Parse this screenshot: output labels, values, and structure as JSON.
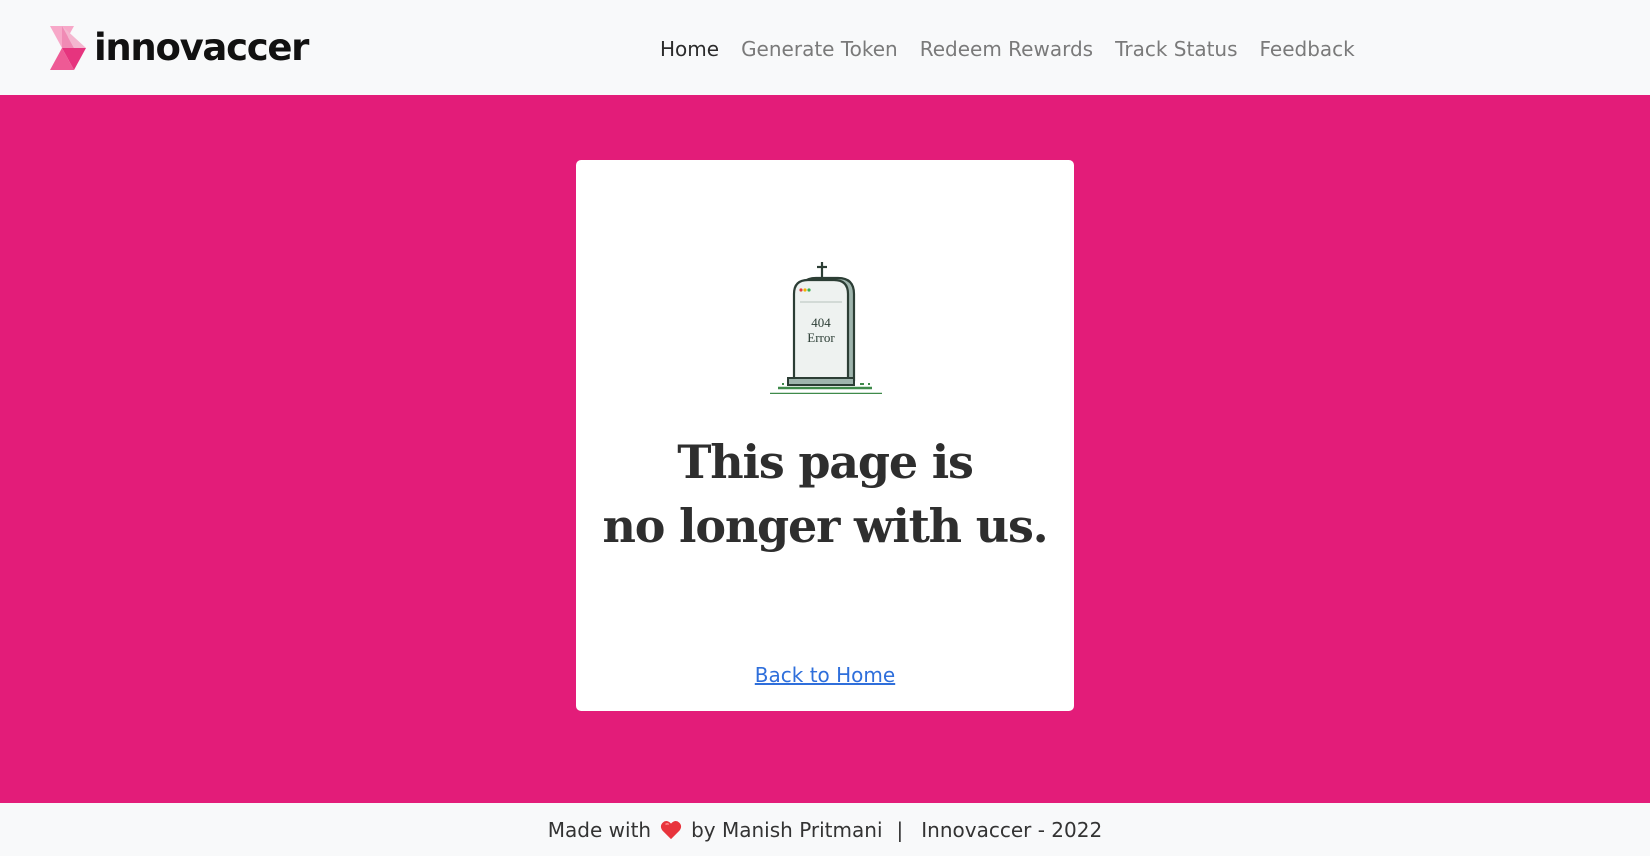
{
  "header": {
    "brand_name": "innovaccer",
    "brand_icon": "innovaccer-logo-mark",
    "nav": [
      {
        "label": "Home",
        "active": true
      },
      {
        "label": "Generate Token",
        "active": false
      },
      {
        "label": "Redeem Rewards",
        "active": false
      },
      {
        "label": "Track Status",
        "active": false
      },
      {
        "label": "Feedback",
        "active": false
      }
    ]
  },
  "main": {
    "illustration": {
      "icon": "tombstone-icon",
      "line1": "404",
      "line2": "Error"
    },
    "message_line1": "This page is",
    "message_line2": "no longer with us.",
    "back_link": "Back to Home"
  },
  "footer": {
    "made_with": "Made with",
    "heart_icon": "heart-icon",
    "by": "by Manish Pritmani",
    "separator": "|",
    "copyright": "Innovaccer - 2022"
  },
  "colors": {
    "accent": "#e31c79",
    "bar_background": "#f8f9fa",
    "card": "#ffffff",
    "link": "#2f6fdb",
    "heart": "#e8343c"
  }
}
